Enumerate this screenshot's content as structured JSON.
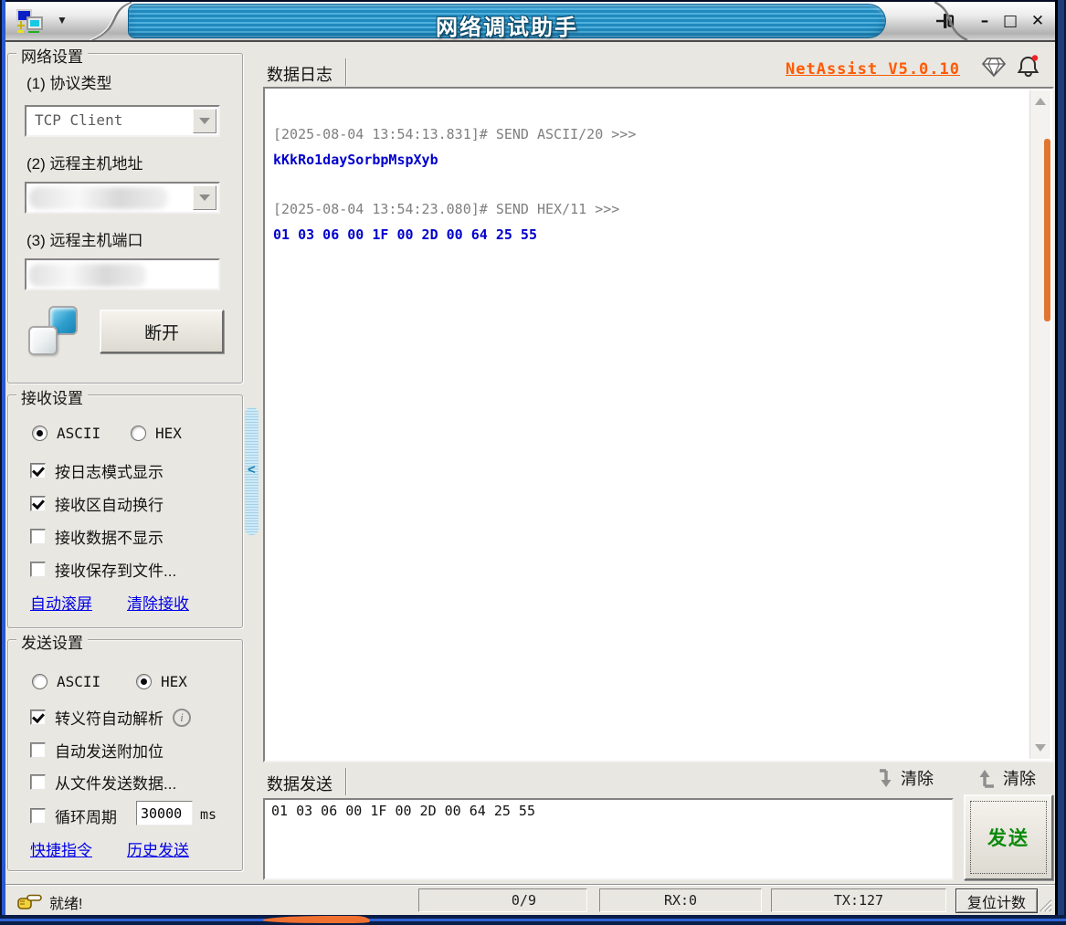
{
  "window": {
    "title": "网络调试助手",
    "dropdown_glyph": "▼",
    "minimize_glyph": "–",
    "maximize_glyph": "□",
    "close_glyph": "✕"
  },
  "network_settings": {
    "title": "网络设置",
    "protocol_label": "(1) 协议类型",
    "protocol_value": "TCP Client",
    "host_label": "(2) 远程主机地址",
    "host_value_redacted": true,
    "port_label": "(3) 远程主机端口",
    "port_value_redacted": true,
    "disconnect_button": "断开"
  },
  "receive_settings": {
    "title": "接收设置",
    "radio_ascii": {
      "label": "ASCII",
      "selected": true
    },
    "radio_hex": {
      "label": "HEX",
      "selected": false
    },
    "checkboxes": [
      {
        "label": "按日志模式显示",
        "checked": true
      },
      {
        "label": "接收区自动换行",
        "checked": true
      },
      {
        "label": "接收数据不显示",
        "checked": false
      },
      {
        "label": "接收保存到文件...",
        "checked": false
      }
    ],
    "links": [
      {
        "label": "自动滚屏"
      },
      {
        "label": "清除接收"
      }
    ]
  },
  "send_settings": {
    "title": "发送设置",
    "radio_ascii": {
      "label": "ASCII",
      "selected": false
    },
    "radio_hex": {
      "label": "HEX",
      "selected": true
    },
    "checkboxes": [
      {
        "label": "转义符自动解析",
        "checked": true,
        "has_info_icon": true
      },
      {
        "label": "自动发送附加位",
        "checked": false
      },
      {
        "label": "从文件发送数据...",
        "checked": false
      },
      {
        "label": "循环周期",
        "checked": false
      }
    ],
    "cycle_value": "30000",
    "cycle_unit": "ms",
    "links": [
      {
        "label": "快捷指令"
      },
      {
        "label": "历史发送"
      }
    ]
  },
  "log_panel": {
    "tab_label": "数据日志",
    "version_link": "NetAssist V5.0.10",
    "entries": [
      {
        "meta": "[2025-08-04 13:54:13.831]# SEND ASCII/20 >>>",
        "data": "kKkRo1daySorbpMspXyb"
      },
      {
        "meta": "[2025-08-04 13:54:23.080]# SEND HEX/11 >>>",
        "data": "01 03 06 00 1F 00 2D 00 64 25 55"
      }
    ]
  },
  "send_panel": {
    "tab_label": "数据发送",
    "clear_recv_label": "清除",
    "clear_send_label": "清除",
    "input_value": "01 03 06 00 1F 00 2D 00 64 25 55",
    "send_button": "发送"
  },
  "status_bar": {
    "status_text": "就绪!",
    "packet_count": "0/9",
    "rx_count": "RX:0",
    "tx_count": "TX:127",
    "reset_button": "复位计数"
  },
  "icons": {
    "app": "network-computers",
    "titlebar_pin": "pushpin",
    "version_gem": "diamond",
    "notifications": "bell-with-red-dot",
    "connection_state": "two-overlapping-squares",
    "escape_info": "circle-i",
    "info_glyph": "i",
    "clear_recv": "arrow-down",
    "clear_send": "arrow-up",
    "status": "pointing-hand",
    "splitter_glyph": "<"
  },
  "colors": {
    "title_bar_blue": "#2089bd",
    "version_orange": "#ff5a00",
    "send_green": "#0a8a0a",
    "link_blue": "#0000e8",
    "log_meta_gray": "#7f7f7f",
    "log_data_blue": "#0000cc",
    "scroll_thumb_orange": "#e0762f",
    "frame_navy": "#0a1d46"
  }
}
